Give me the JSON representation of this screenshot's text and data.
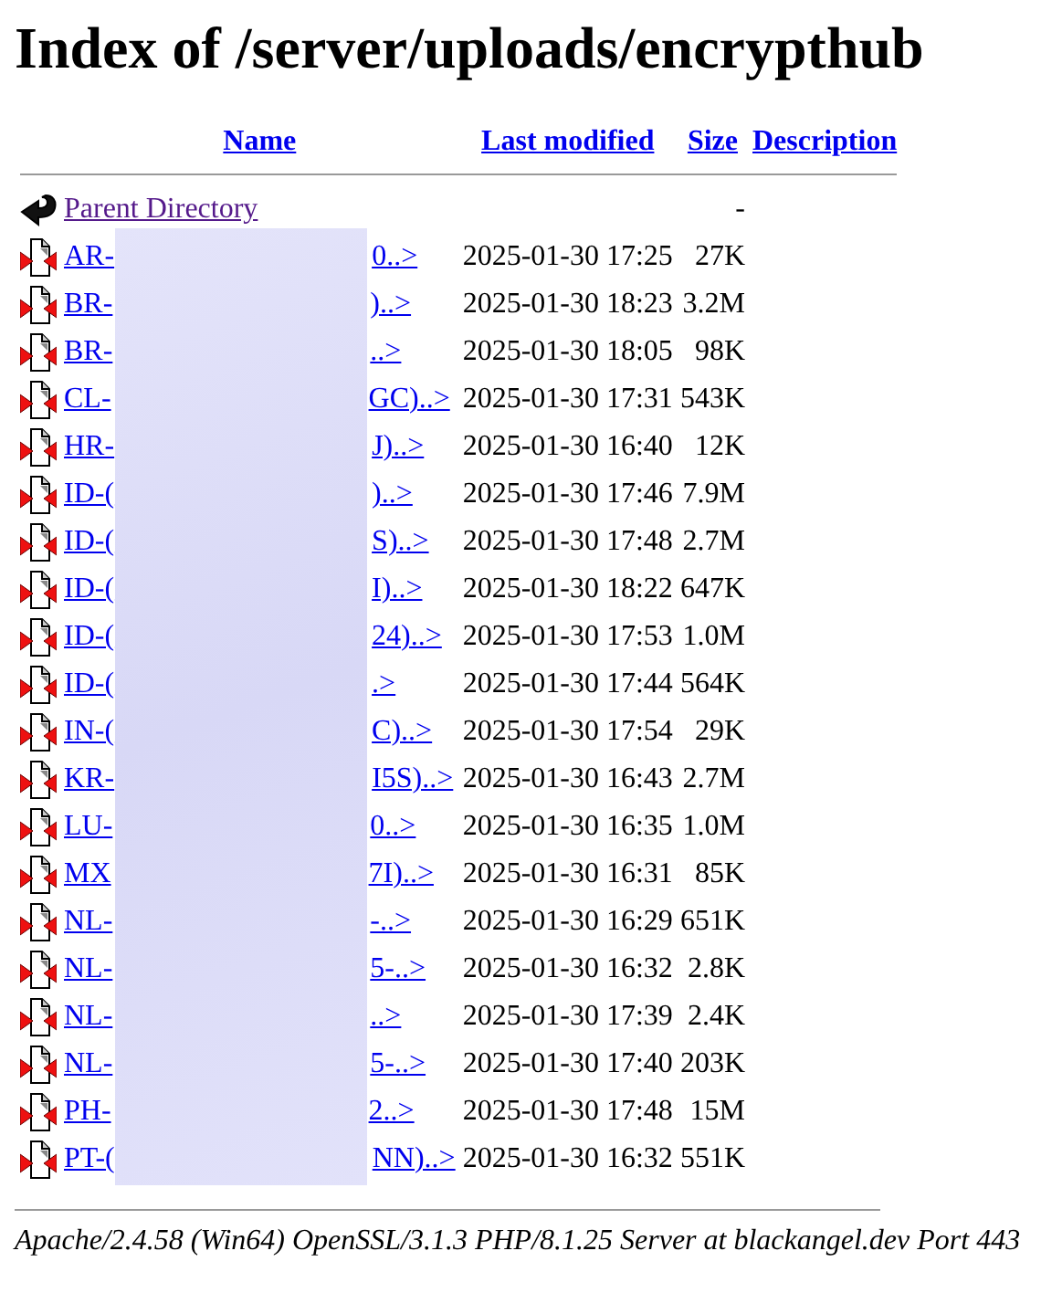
{
  "title": "Index of /server/uploads/encrypthub",
  "columns": [
    "Name",
    "Last modified",
    "Size",
    "Description"
  ],
  "parent": {
    "name": "Parent Directory",
    "size": "-"
  },
  "files": [
    {
      "start": "AR-",
      "end": "0..>",
      "modified": "2025-01-30 17:25",
      "size": "27K"
    },
    {
      "start": "BR-",
      "end": ")..>",
      "modified": "2025-01-30 18:23",
      "size": "3.2M"
    },
    {
      "start": "BR-",
      "end": "..>",
      "modified": "2025-01-30 18:05",
      "size": "98K"
    },
    {
      "start": "CL-",
      "end": "GC)..>",
      "modified": "2025-01-30 17:31",
      "size": "543K"
    },
    {
      "start": "HR-",
      "end": "J)..>",
      "modified": "2025-01-30 16:40",
      "size": "12K"
    },
    {
      "start": "ID-(",
      "end": ")..>",
      "modified": "2025-01-30 17:46",
      "size": "7.9M"
    },
    {
      "start": "ID-(",
      "end": "S)..>",
      "modified": "2025-01-30 17:48",
      "size": "2.7M"
    },
    {
      "start": "ID-(",
      "end": "I)..>",
      "modified": "2025-01-30 18:22",
      "size": "647K"
    },
    {
      "start": "ID-(",
      "end": "24)..>",
      "modified": "2025-01-30 17:53",
      "size": "1.0M"
    },
    {
      "start": "ID-(",
      "end": ".>",
      "modified": "2025-01-30 17:44",
      "size": "564K"
    },
    {
      "start": "IN-(",
      "end": "C)..>",
      "modified": "2025-01-30 17:54",
      "size": "29K"
    },
    {
      "start": "KR-",
      "end": "I5S)..>",
      "modified": "2025-01-30 16:43",
      "size": "2.7M"
    },
    {
      "start": "LU-",
      "end": "0..>",
      "modified": "2025-01-30 16:35",
      "size": "1.0M"
    },
    {
      "start": "MX",
      "end": "7I)..>",
      "modified": "2025-01-30 16:31",
      "size": "85K"
    },
    {
      "start": "NL-",
      "end": "-..>",
      "modified": "2025-01-30 16:29",
      "size": "651K"
    },
    {
      "start": "NL-",
      "end": "5-..>",
      "modified": "2025-01-30 16:32",
      "size": "2.8K"
    },
    {
      "start": "NL-",
      "end": "..>",
      "modified": "2025-01-30 17:39",
      "size": "2.4K"
    },
    {
      "start": "NL-",
      "end": "5-..>",
      "modified": "2025-01-30 17:40",
      "size": "203K"
    },
    {
      "start": "PH-",
      "end": "2..>",
      "modified": "2025-01-30 17:48",
      "size": "15M"
    },
    {
      "start": "PT-(",
      "end": "NN)..>",
      "modified": "2025-01-30 16:32",
      "size": "551K"
    }
  ],
  "address": "Apache/2.4.58 (Win64) OpenSSL/3.1.3 PHP/8.1.25 Server at blackangel.dev Port 443"
}
